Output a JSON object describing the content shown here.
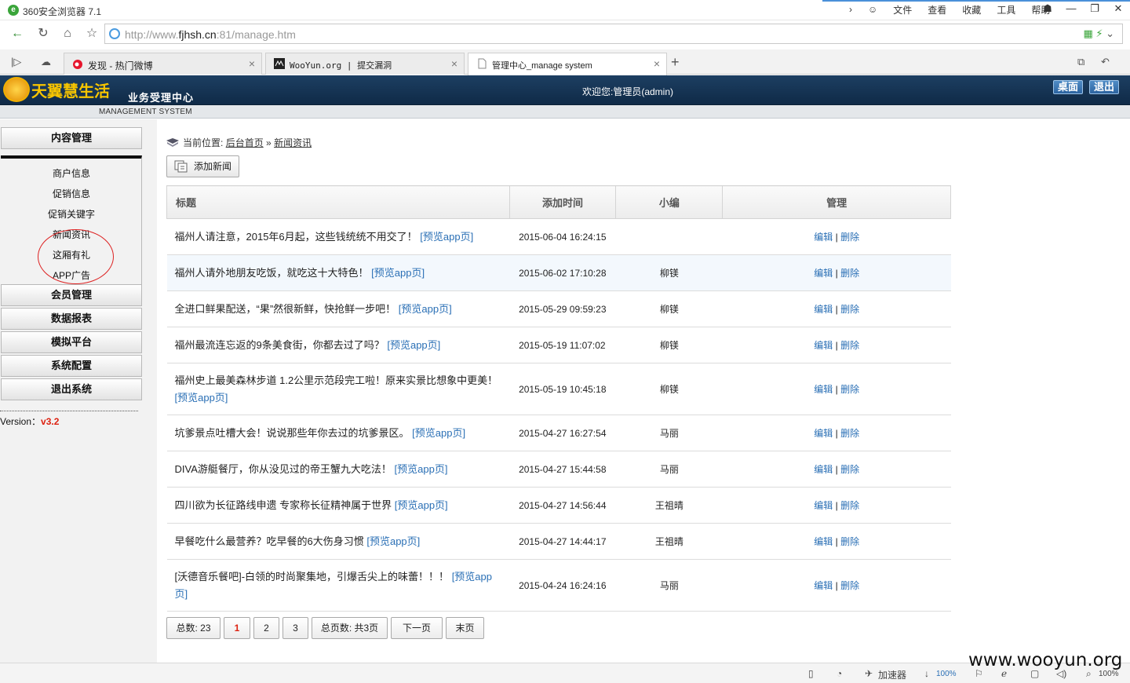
{
  "browser": {
    "app_title": "360安全浏览器 7.1",
    "menu": [
      "文件",
      "查看",
      "收藏",
      "工具",
      "帮助"
    ],
    "url_prefix": "http://www.",
    "url_domain": "fjhsh.cn",
    "url_suffix": ":81/manage.htm",
    "tabs": [
      {
        "label": "发现 - 热门微博",
        "icon": "weibo-icon"
      },
      {
        "label": "WooYun.org | 提交漏洞",
        "icon": "wooyun-icon"
      },
      {
        "label": "管理中心_manage system",
        "icon": "page-icon"
      }
    ]
  },
  "header": {
    "brand": "天翼慧生活",
    "subtitle": "业务受理中心",
    "welcome": "欢迎您:管理员(admin)",
    "desktop_btn": "桌面",
    "logout_btn": "退出",
    "subbar_text": "MANAGEMENT SYSTEM"
  },
  "sidebar": {
    "content_section": "内容管理",
    "content_items": [
      "商户信息",
      "促销信息",
      "促销关键字",
      "新闻资讯",
      "这厢有礼",
      "APP广告"
    ],
    "sections": [
      "会员管理",
      "数据报表",
      "模拟平台",
      "系统配置",
      "退出系统"
    ],
    "version_label": "Version：",
    "version_value": "v3.2"
  },
  "breadcrumb": {
    "prefix": "当前位置:",
    "home": "后台首页",
    "sep": "»",
    "current": "新闻资讯"
  },
  "add_button": "添加新闻",
  "table": {
    "headers": [
      "标题",
      "添加时间",
      "小编",
      "管理"
    ],
    "edit_label": "编辑",
    "sep": "|",
    "delete_label": "删除",
    "preview_label": "[预览app页]",
    "rows": [
      {
        "title": "福州人请注意，2015年6月起，这些钱统统不用交了！",
        "preview": "[预览app页]",
        "time": "2015-06-04 16:24:15",
        "editor": ""
      },
      {
        "title": "福州人请外地朋友吃饭，就吃这十大特色！",
        "preview": "[预览app页]",
        "time": "2015-06-02 17:10:28",
        "editor": "柳镁"
      },
      {
        "title": "全进口鲜果配送，“果”然很新鲜，快抢鲜一步吧！",
        "preview": "[预览app页]",
        "time": "2015-05-29 09:59:23",
        "editor": "柳镁"
      },
      {
        "title": "福州最流连忘返的9条美食街，你都去过了吗？",
        "preview": "[预览app页]",
        "time": "2015-05-19 11:07:02",
        "editor": "柳镁"
      },
      {
        "title": "福州史上最美森林步道 1.2公里示范段完工啦！原来实景比想象中更美！",
        "preview": "[预览app页]",
        "time": "2015-05-19 10:45:18",
        "editor": "柳镁"
      },
      {
        "title": "坑爹景点吐槽大会！说说那些年你去过的坑爹景区。",
        "preview": "[预览app页]",
        "time": "2015-04-27 16:27:54",
        "editor": "马丽"
      },
      {
        "title": "DIVA游艇餐厅，你从没见过的帝王蟹九大吃法！",
        "preview": "[预览app页]",
        "time": "2015-04-27 15:44:58",
        "editor": "马丽"
      },
      {
        "title": "四川欲为长征路线申遗 专家称长征精神属于世界",
        "preview": "[预览app页]",
        "time": "2015-04-27 14:56:44",
        "editor": "王祖晴"
      },
      {
        "title": "早餐吃什么最营养？吃早餐的6大伤身习惯",
        "preview": "[预览app页]",
        "time": "2015-04-27 14:44:17",
        "editor": "王祖晴"
      },
      {
        "title": "[沃德音乐餐吧]-白领的时尚聚集地，引爆舌尖上的味蕾！！！",
        "preview": "[预览app页]",
        "time": "2015-04-24 16:24:16",
        "editor": "马丽"
      }
    ]
  },
  "pager": {
    "total": "总数: 23",
    "pages": [
      "1",
      "2",
      "3"
    ],
    "current_page": "1",
    "page_count": "总页数: 共3页",
    "next": "下一页",
    "last": "末页"
  },
  "statusbar": {
    "accelerator": "加速器",
    "download": "100%",
    "zoom": "100%"
  },
  "watermark": "www.wooyun.org"
}
